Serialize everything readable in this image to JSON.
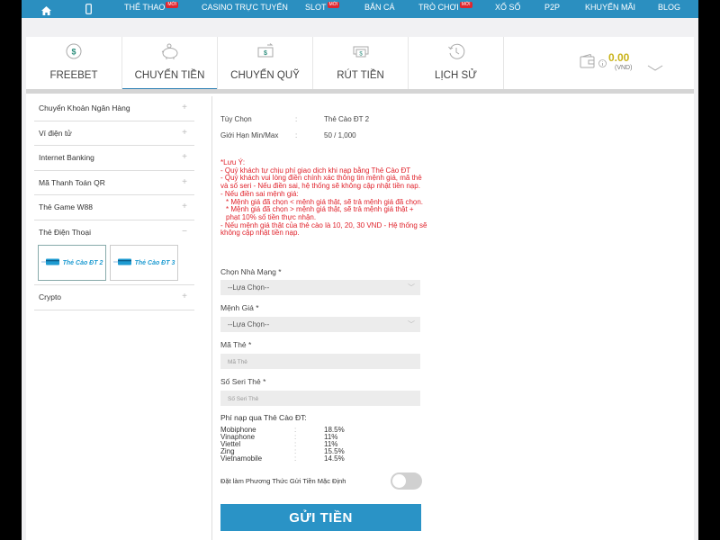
{
  "topnav": {
    "items": [
      {
        "label": "THỂ THAO",
        "badge": "MỚI"
      },
      {
        "label": "CASINO TRỰC TUYẾN",
        "badge": null
      },
      {
        "label": "SLOT",
        "badge": "MỚI"
      },
      {
        "label": "BẮN CÁ",
        "badge": null
      },
      {
        "label": "TRÒ CHƠI",
        "badge": "MỚI"
      },
      {
        "label": "XỔ SỐ",
        "badge": null
      },
      {
        "label": "P2P",
        "badge": null
      },
      {
        "label": "KHUYẾN MÃI",
        "badge": null
      },
      {
        "label": "BLOG",
        "badge": null
      }
    ]
  },
  "tabs": [
    {
      "label": "FREEBET",
      "icon": "dollar-coin-icon"
    },
    {
      "label": "CHUYỂN TIỀN",
      "icon": "piggy-bank-icon",
      "active": true
    },
    {
      "label": "CHUYỂN QUỸ",
      "icon": "transfer-funds-icon"
    },
    {
      "label": "RÚT TIỀN",
      "icon": "withdraw-icon"
    },
    {
      "label": "LỊCH SỬ",
      "icon": "history-clock-icon"
    }
  ],
  "balance": {
    "amount": "0.00",
    "currency": "(VND)"
  },
  "sidebar": {
    "items": [
      {
        "label": "Chuyển Khoản Ngân Hàng"
      },
      {
        "label": "Ví điện tử"
      },
      {
        "label": "Internet Banking"
      },
      {
        "label": "Mã Thanh Toán QR"
      },
      {
        "label": "Thẻ Game W88"
      },
      {
        "label": "Thẻ Điện Thoại",
        "expanded": true
      },
      {
        "label": "Crypto"
      }
    ],
    "phone_cards": [
      {
        "label": "Thẻ Cào ĐT 2",
        "selected": true
      },
      {
        "label": "Thẻ Cào ĐT 3",
        "selected": false
      }
    ]
  },
  "form": {
    "option_label": "Tùy Chọn",
    "option_value": "Thẻ Cào ĐT 2",
    "limit_label": "Giới Hạn Min/Max",
    "limit_value": "50 / 1,000",
    "separator": ":",
    "notice": [
      "*Lưu Ý:",
      "- Quý khách tự chịu phí giao dịch khi nạp bằng Thẻ Cào ĐT",
      "- Quý khách vui lòng điền chính xác thông tin mệnh giá, mã thẻ và số seri - Nếu điền sai, hệ thống sẽ không cập nhật tiền nạp.",
      "- Nếu điền sai mệnh giá:",
      "   * Mệnh giá đã chọn < mệnh giá thật, sẽ trả mệnh giá đã chọn.",
      "   * Mệnh giá đã chọn > mệnh giá thật, sẽ trả mệnh giá thật + phạt 10% số tiền thực nhận.",
      "- Nếu mệnh giá thật của thẻ cào là 10, 20, 30 VND - Hệ thống sẽ không cập nhật tiền nạp."
    ],
    "network_label": "Chọn Nhà Mạng *",
    "network_value": "--Lựa Chọn--",
    "denomination_label": "Mệnh Giá *",
    "denomination_value": "--Lựa Chọn--",
    "card_code_label": "Mã Thẻ *",
    "card_code_placeholder": "Mã Thẻ",
    "serial_label": "Số Seri Thẻ *",
    "serial_placeholder": "Số Seri Thẻ",
    "fee_title": "Phí nạp qua Thẻ Cào ĐT:",
    "fees": [
      {
        "carrier": "Mobiphone",
        "fee": "18.5%"
      },
      {
        "carrier": "Vinaphone",
        "fee": "11%"
      },
      {
        "carrier": "Viettel",
        "fee": "11%"
      },
      {
        "carrier": "Zing",
        "fee": "15.5%"
      },
      {
        "carrier": "Vietnamobile",
        "fee": "14.5%"
      }
    ],
    "default_toggle_label": "Đặt làm Phương Thức Gửi Tiền Mặc Định",
    "default_toggle_on": false,
    "submit_label": "GỬI TIỀN"
  },
  "colors": {
    "nav_blue": "#2b8fc0",
    "button_blue": "#2a93c6",
    "notice_red": "#e0222b",
    "balance_gold": "#c9b31a"
  }
}
